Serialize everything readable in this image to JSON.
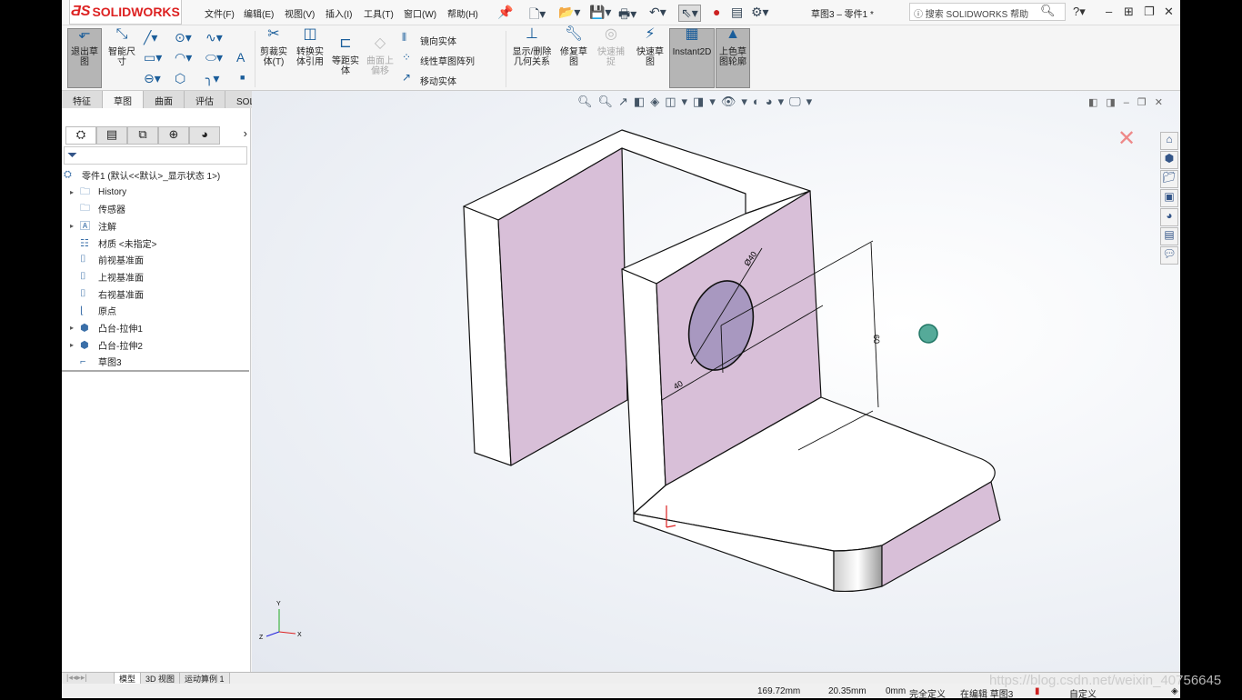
{
  "app": {
    "brand": "SOLIDWORKS",
    "doc_title": "草图3 – 零件1 *",
    "search_placeholder": "搜索 SOLIDWORKS 帮助"
  },
  "menu": [
    "文件(F)",
    "编辑(E)",
    "视图(V)",
    "插入(I)",
    "工具(T)",
    "窗口(W)",
    "帮助(H)"
  ],
  "ribbon": {
    "exit_sketch": "退出草图",
    "smart_dim": "智能尺寸",
    "trim": "剪裁实体(T)",
    "convert": "转换实体引用",
    "offset": "等距实体",
    "surface_offset": "曲面上偏移",
    "mirror": "镜向实体",
    "linear_pattern": "线性草图阵列",
    "move": "移动实体",
    "show_relations": "显示/删除几何关系",
    "repair": "修复草图",
    "quick_snap": "快速捕捉",
    "rapid_sketch": "快速草图",
    "instant2d": "Instant2D",
    "shaded_sketch": "上色草图轮廓"
  },
  "tabs": [
    "特征",
    "草图",
    "曲面",
    "评估",
    "SOLIDWORKS 插件"
  ],
  "tree": [
    {
      "label": "零件1  (默认<<默认>_显示状态 1>)",
      "icon": "part-icon",
      "arrow": false
    },
    {
      "label": "History",
      "icon": "history-folder-icon",
      "arrow": true
    },
    {
      "label": "传感器",
      "icon": "sensor-folder-icon",
      "arrow": false
    },
    {
      "label": "注解",
      "icon": "annotation-folder-icon",
      "arrow": true
    },
    {
      "label": "材质 <未指定>",
      "icon": "material-icon",
      "arrow": false
    },
    {
      "label": "前视基准面",
      "icon": "plane-icon",
      "arrow": false
    },
    {
      "label": "上视基准面",
      "icon": "plane-icon",
      "arrow": false
    },
    {
      "label": "右视基准面",
      "icon": "plane-icon",
      "arrow": false
    },
    {
      "label": "原点",
      "icon": "origin-icon",
      "arrow": false
    },
    {
      "label": "凸台-拉伸1",
      "icon": "extrude-icon",
      "arrow": true
    },
    {
      "label": "凸台-拉伸2",
      "icon": "extrude-icon",
      "arrow": true
    },
    {
      "label": "草图3",
      "icon": "sketch-icon",
      "arrow": false
    }
  ],
  "model": {
    "dim_diameter": "Ø40",
    "dim_horizontal": "40",
    "dim_vertical": "60",
    "face_color": "#d8bfd8",
    "hole_color": "#a898c0"
  },
  "bottom_tabs": [
    "模型",
    "3D 视图",
    "运动算例 1"
  ],
  "status": {
    "x": "169.72mm",
    "y": "20.35mm",
    "z": "0mm",
    "state": "完全定义",
    "editing": "在编辑 草图3",
    "units": "自定义"
  },
  "watermark": "https://blog.csdn.net/weixin_40756645"
}
